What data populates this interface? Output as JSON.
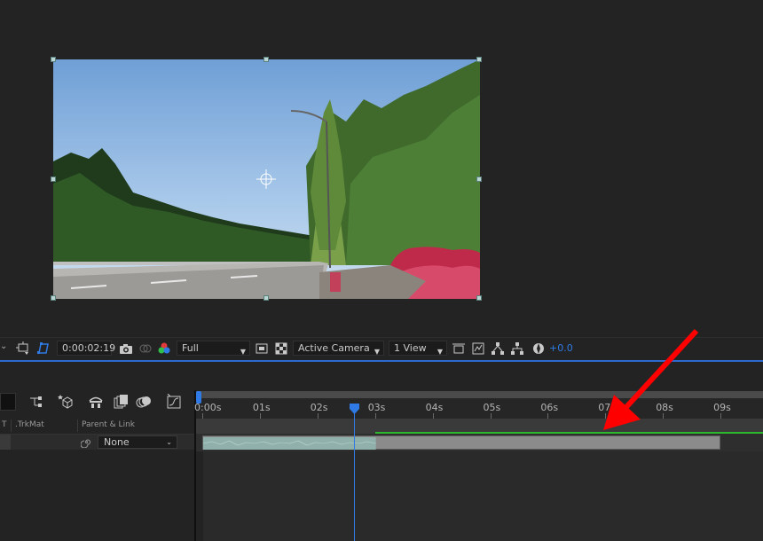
{
  "viewer": {
    "timecode": "0:00:02:19",
    "resolution": "Full",
    "camera": "Active Camera",
    "views": "1 View",
    "exposure": "+0.0"
  },
  "timeline": {
    "columns": {
      "trkmat": ".TrkMat",
      "parent_link": "Parent & Link",
      "t": "T"
    },
    "layer": {
      "parent_value": "None"
    },
    "ruler": [
      "0:00s",
      "01s",
      "02s",
      "03s",
      "04s",
      "05s",
      "06s",
      "07s",
      "08s",
      "09s"
    ],
    "playhead_seconds": 2.63,
    "layer_duration_seconds": 9.0,
    "cached_until_seconds": 3.0
  },
  "colors": {
    "accent": "#2f7ae5",
    "cache_green": "#2eb82e",
    "annotation_arrow": "#ff0000"
  },
  "icons": [
    "camera-icon",
    "channels-icon",
    "color-wheel-icon",
    "snapshot-icon",
    "region-of-interest-icon",
    "transparency-grid-icon",
    "fast-preview-icon",
    "3d-draft-icon",
    "flowchart-icon",
    "reset-exposure-icon",
    "comp-flowchart-icon",
    "frame-blending-icon",
    "motion-blur-icon",
    "graph-editor-icon",
    "spiral-pickwhip-icon",
    "red-annotation-arrow"
  ]
}
